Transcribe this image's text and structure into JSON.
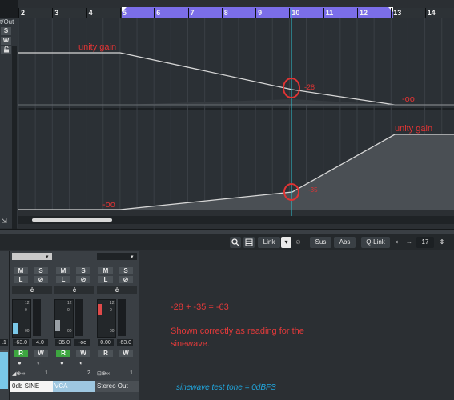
{
  "arranger": {
    "io_label": "t/Out",
    "left_buttons": [
      "S",
      "W"
    ],
    "ruler_marks": [
      "2",
      "3",
      "4",
      "5",
      "6",
      "7",
      "8",
      "9",
      "10",
      "11",
      "12",
      "13",
      "14"
    ]
  },
  "annotations": {
    "unity_gain_1": "unity gain",
    "minus_28": "-28",
    "minus_inf_1": "-oo",
    "unity_gain_2": "unity gain",
    "minus_inf_2": "-oo",
    "minus_35": "-35"
  },
  "mixer_toolbar": {
    "link": "Link",
    "sus": "Sus",
    "abs": "Abs",
    "qlink": "Q-Link",
    "count": "17"
  },
  "channels": [
    {
      "name": "0db SINE",
      "gain": "-63.0",
      "pan": "4.0",
      "number": "1",
      "left_readout": ".1",
      "meter_top": "12",
      "meter_mid": "0",
      "meter_bot": "00"
    },
    {
      "name": "VCA",
      "gain": "-35.0",
      "pan": "-oo",
      "number": "2",
      "meter_top": "12",
      "meter_mid": "0",
      "meter_bot": "00"
    },
    {
      "name": "Stereo Out",
      "gain": "0.00",
      "pan": "-63.0",
      "number": "1",
      "meter_top": "12",
      "meter_mid": "0",
      "meter_bot": "00"
    }
  ],
  "strip_buttons": {
    "m": "M",
    "s": "S",
    "l": "L",
    "r": "R",
    "w": "W"
  },
  "notes": {
    "equation": "-28 + -35 = -63",
    "shown_line1": "Shown correctly as reading for the",
    "shown_line2": "sinewave.",
    "test_tone": "sinewave test tone = 0dBFS"
  },
  "colors": {
    "accent_purple": "#7b6ee9",
    "annotation_red": "#e03434",
    "cursor_cyan": "#2fc4d4",
    "note_blue": "#20a8e0",
    "record_green": "#3da640"
  }
}
